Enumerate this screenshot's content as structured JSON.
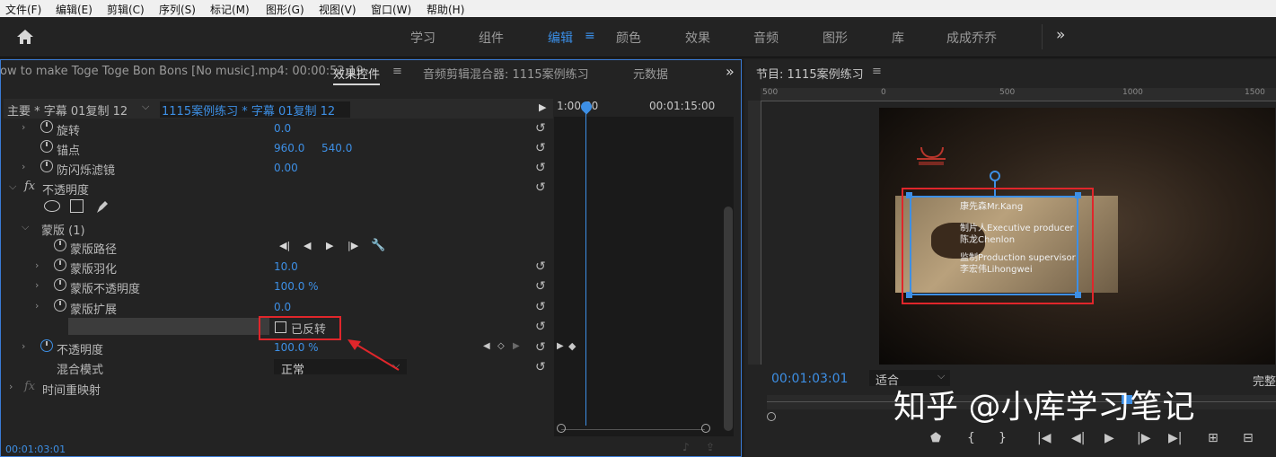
{
  "menu": [
    "文件(F)",
    "编辑(E)",
    "剪辑(C)",
    "序列(S)",
    "标记(M)",
    "图形(G)",
    "视图(V)",
    "窗口(W)",
    "帮助(H)"
  ],
  "workspaces": {
    "items": [
      "学习",
      "组件",
      "编辑",
      "颜色",
      "效果",
      "音频",
      "图形",
      "库",
      "成成乔乔"
    ],
    "active": "编辑",
    "more": "»"
  },
  "effect_panel": {
    "source_clip": "ow to make Toge Toge Bon Bons [No music].mp4: 00:00:52:19",
    "tabs": [
      "效果控件",
      "音频剪辑混合器: 1115案例练习",
      "元数据"
    ],
    "active_tab": "效果控件",
    "clip_main": "主要 * 字幕 01复制 12",
    "clip_seq": "1115案例练习 * 字幕 01复制 12",
    "ruler_start": "1:00:00",
    "ruler_mid": "00:01:15:00",
    "current_time": "00:01:03:01",
    "rotation_label": "旋转",
    "rotation_value": "0.0",
    "anchor_label": "锚点",
    "anchor_x": "960.0",
    "anchor_y": "540.0",
    "antiflicker_label": "防闪烁滤镜",
    "antiflicker_value": "0.00",
    "opacity_section": "不透明度",
    "mask_label": "蒙版 (1)",
    "mask_path_label": "蒙版路径",
    "mask_feather_label": "蒙版羽化",
    "mask_feather_value": "10.0",
    "mask_opacity_label": "蒙版不透明度",
    "mask_opacity_value": "100.0 %",
    "mask_expand_label": "蒙版扩展",
    "mask_expand_value": "0.0",
    "inverted_label": "已反转",
    "opacity_label": "不透明度",
    "opacity_value": "100.0 %",
    "blend_label": "混合模式",
    "blend_value": "正常",
    "time_remap_label": "时间重映射"
  },
  "program": {
    "title": "节目: 1115案例练习",
    "ruler": [
      "500",
      "0",
      "500",
      "1000",
      "1500"
    ],
    "timecode": "00:01:03:01",
    "fit": "适合",
    "quality": "完整",
    "overlay_lines": [
      "康先森Mr.Kang",
      "制片人Executive producer",
      "陈龙Chenlon",
      "监制Production supervisor",
      "李宏伟Lihongwei"
    ],
    "watermark": "知乎 @小库学习笔记"
  },
  "colors": {
    "accent": "#3d8fe5",
    "highlight_box": "#e0262b",
    "panel_bg": "#232323"
  }
}
